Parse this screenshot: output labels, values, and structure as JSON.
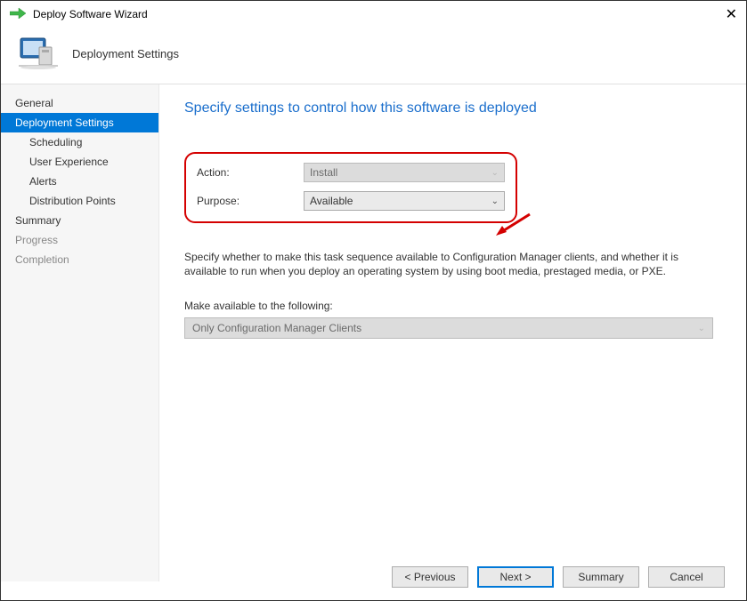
{
  "window": {
    "title": "Deploy Software Wizard"
  },
  "header": {
    "title": "Deployment Settings"
  },
  "sidebar": {
    "items": [
      {
        "label": "General"
      },
      {
        "label": "Deployment Settings"
      },
      {
        "label": "Scheduling"
      },
      {
        "label": "User Experience"
      },
      {
        "label": "Alerts"
      },
      {
        "label": "Distribution Points"
      },
      {
        "label": "Summary"
      },
      {
        "label": "Progress"
      },
      {
        "label": "Completion"
      }
    ]
  },
  "main": {
    "title": "Specify settings to control how this software is deployed",
    "action_label": "Action:",
    "action_value": "Install",
    "purpose_label": "Purpose:",
    "purpose_value": "Available",
    "desc": "Specify whether to make this task sequence available to Configuration Manager clients, and whether it is available to run when you deploy an operating system by using boot media, prestaged media, or PXE.",
    "avail_label": "Make available to the following:",
    "avail_value": "Only Configuration Manager Clients"
  },
  "buttons": {
    "previous": "< Previous",
    "next": "Next >",
    "summary": "Summary",
    "cancel": "Cancel"
  }
}
